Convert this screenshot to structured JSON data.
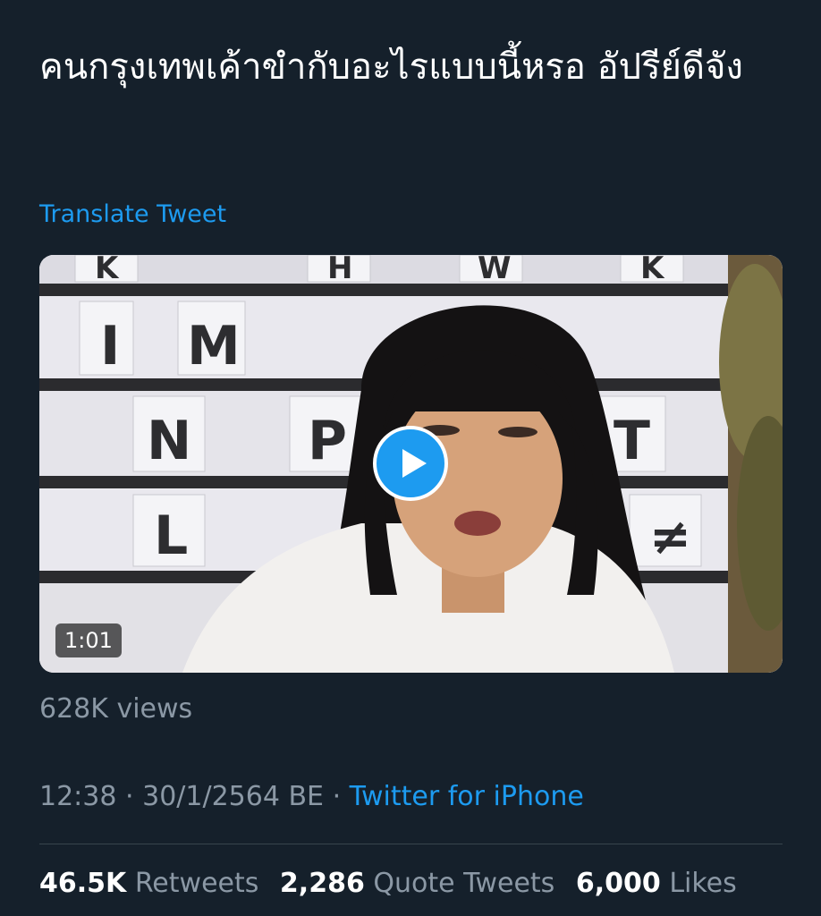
{
  "tweet": {
    "text": "คนกรุงเทพเค้าขำกับอะไรแบบนี้หรอ อัปรีย์ดีจัง",
    "translate_label": "Translate Tweet",
    "video": {
      "duration": "1:01",
      "play_icon": "play-icon",
      "letter_board": [
        "K",
        "H",
        "W",
        "K",
        "I",
        "M",
        "N",
        "P",
        "T",
        "L",
        "≠"
      ]
    },
    "views": "628K views",
    "time": "12:38",
    "date": "30/1/2564 BE",
    "separator": "·",
    "source": "Twitter for iPhone"
  },
  "stats": {
    "retweets_count": "46.5K",
    "retweets_label": "Retweets",
    "quotes_count": "2,286",
    "quotes_label": "Quote Tweets",
    "likes_count": "6,000",
    "likes_label": "Likes"
  },
  "colors": {
    "background": "#15202b",
    "accent": "#1d9bf0",
    "secondary_text": "#8b98a5",
    "primary_text": "#ffffff"
  }
}
